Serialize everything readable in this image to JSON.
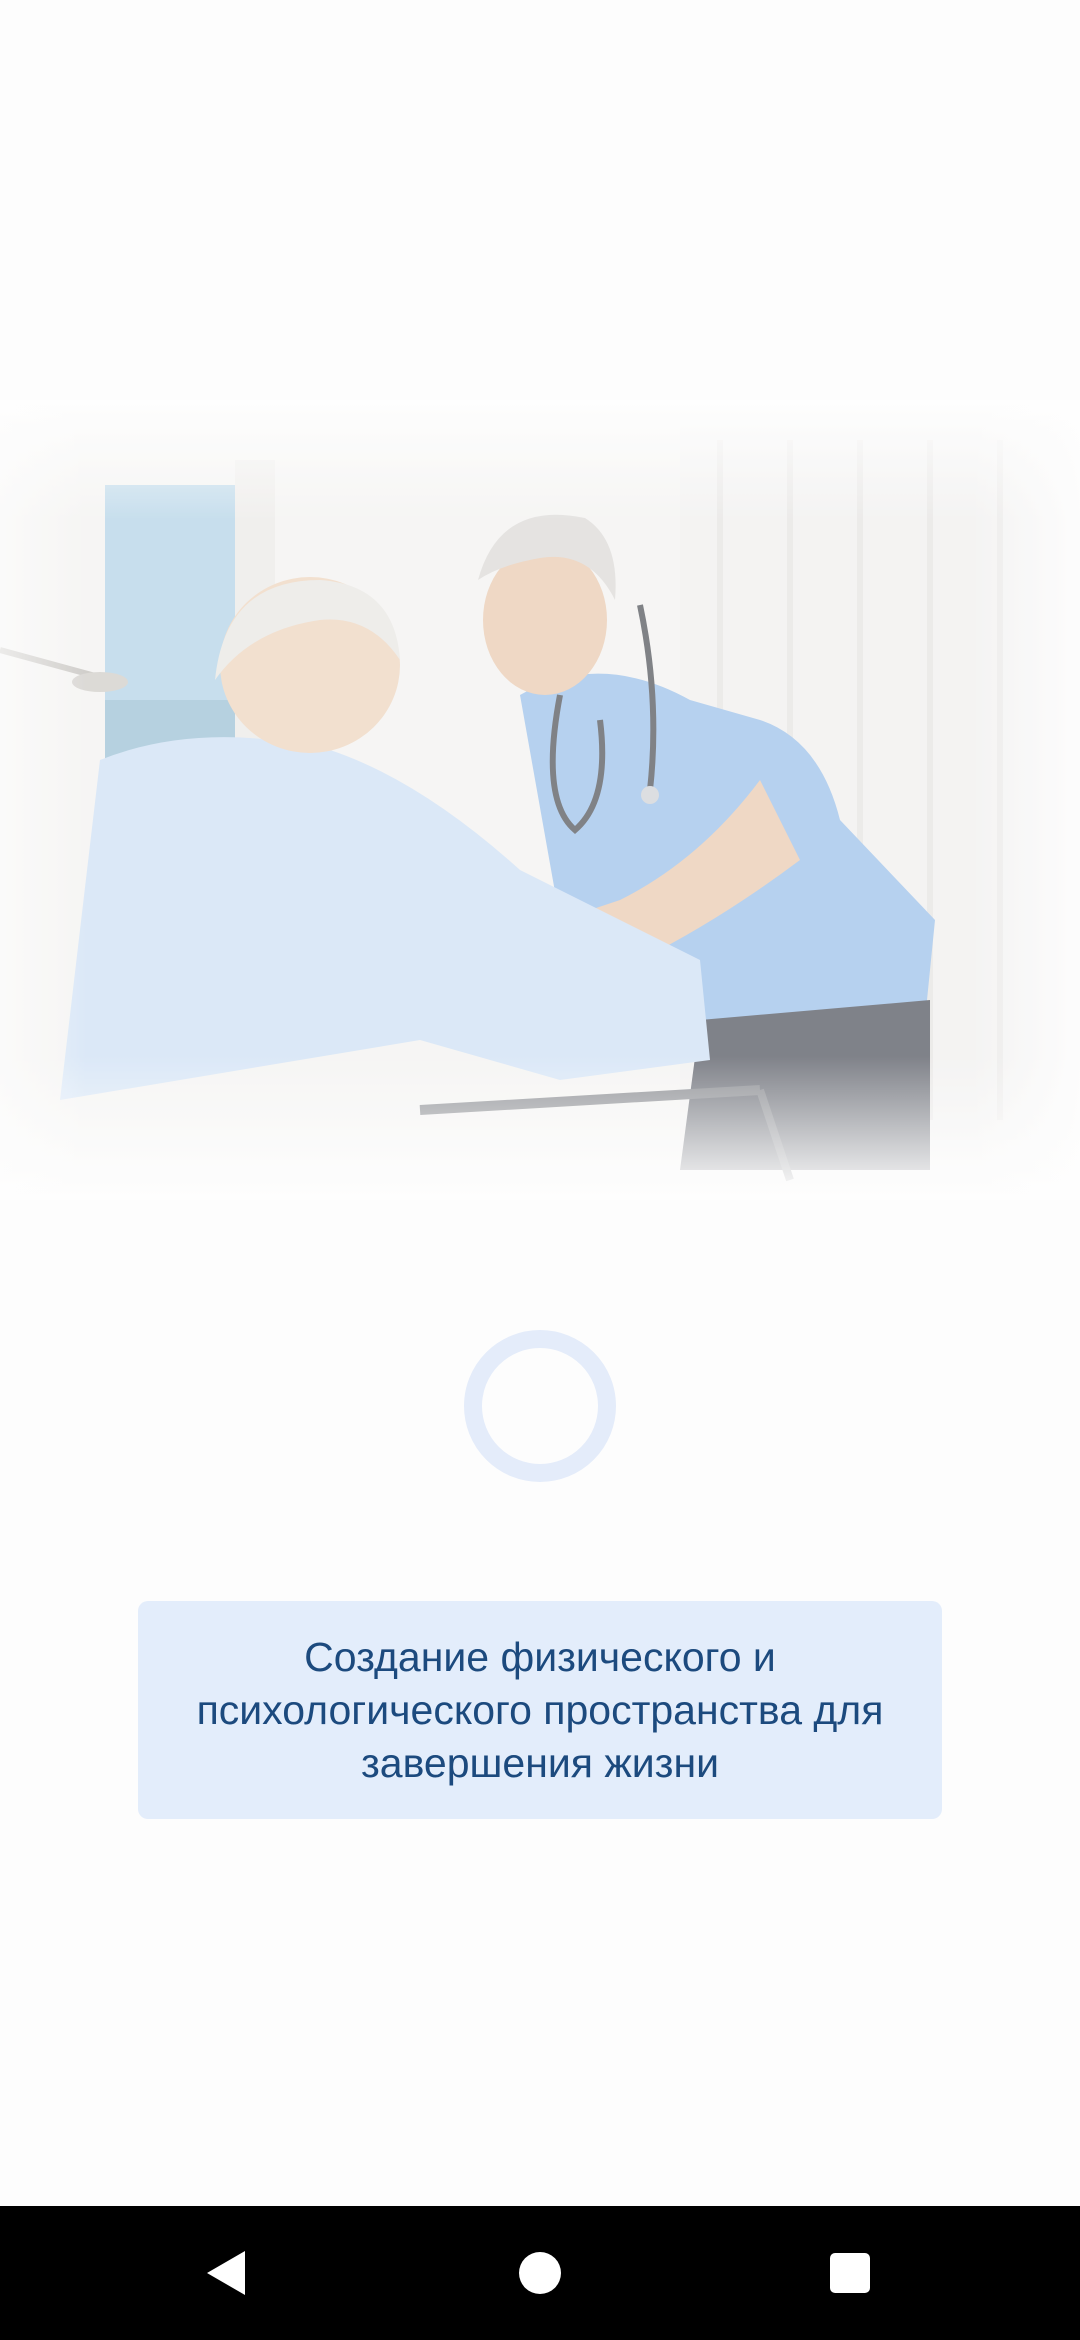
{
  "hero": {
    "image": "nurse-helping-elderly-patient-illustration"
  },
  "loader": {
    "icon": "loading-spinner-icon",
    "color": "#e4ecfa"
  },
  "tagline": {
    "text": "Создание физического и психологического пространства для завершения жизни",
    "text_color": "#1c4a7e",
    "background": "#e3edfb"
  },
  "navigation": {
    "back_icon": "back-triangle-icon",
    "home_icon": "home-circle-icon",
    "recents_icon": "recents-square-icon"
  }
}
